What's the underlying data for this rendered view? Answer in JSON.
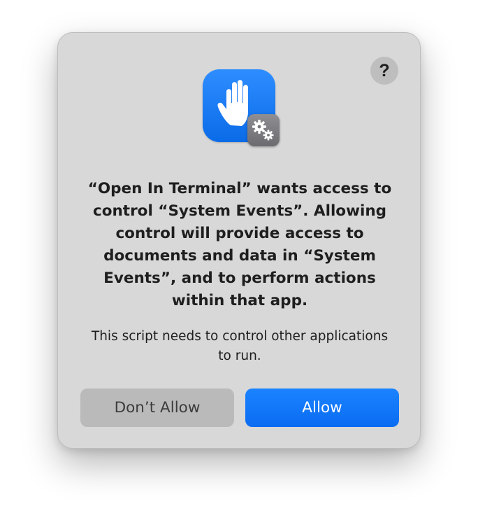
{
  "dialog": {
    "help_label": "?",
    "icon": "privacy-hand-with-gear-icon",
    "title": "“Open In Terminal” wants access to control “System Events”. Allowing control will provide access to documents and data in “System Events”, and to perform actions within that app.",
    "message": "This script needs to control other applications to run.",
    "buttons": {
      "deny_label": "Don’t Allow",
      "allow_label": "Allow"
    }
  },
  "colors": {
    "dialog_background": "#d8d8d8",
    "icon_blue": "#1a7cf7",
    "allow_button": "#0a6cf2",
    "deny_button": "#bababa",
    "badge_gray": "#7a7a7e"
  }
}
